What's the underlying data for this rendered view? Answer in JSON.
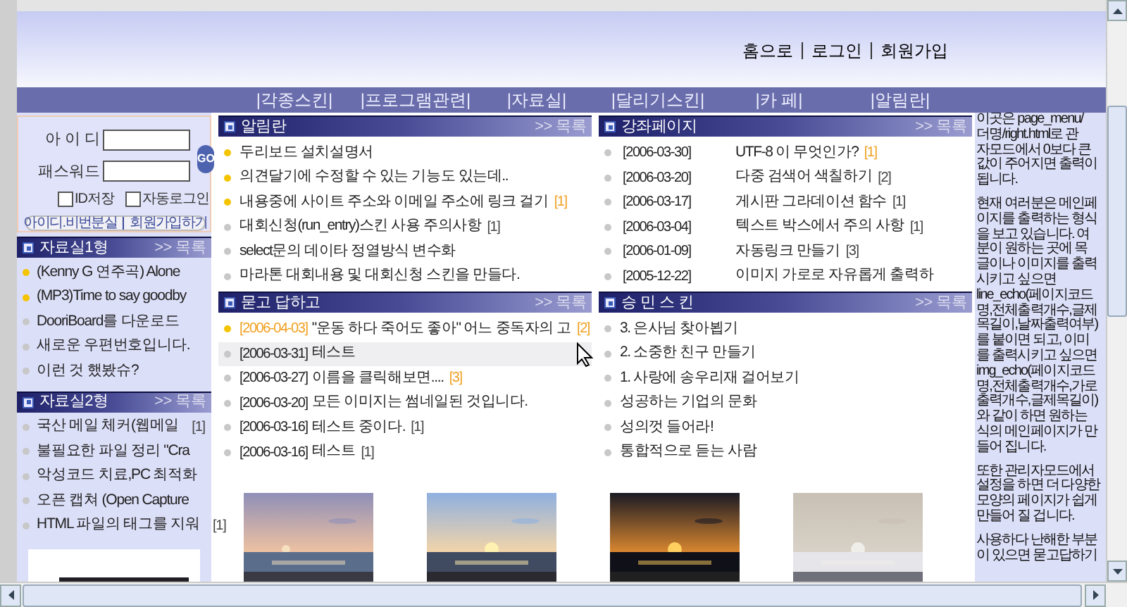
{
  "top_links": [
    {
      "label": "홈으로"
    },
    {
      "label": "로그인"
    },
    {
      "label": "회원가입"
    }
  ],
  "nav": [
    "|각종스킨|",
    "|프로그램관련|",
    "|자료실|",
    "|달리기스킨|",
    "|카 페|",
    "|알림란|"
  ],
  "login": {
    "id_label": "아 이 디",
    "pw_label": "패스워드",
    "go": "GO",
    "checks": [
      {
        "label": "ID저장",
        "checked": false
      },
      {
        "label": "자동로그인",
        "checked": false
      }
    ],
    "links": [
      "아이디.비번분실",
      "회원가입하기"
    ]
  },
  "left_sections": [
    {
      "title": "자료실1형",
      "more": ">> 목록",
      "items": [
        {
          "text": "(Kenny G 연주곡) Alone",
          "new": true
        },
        {
          "text": "(MP3)Time to say goodby",
          "new": true
        },
        {
          "text": "DooriBoard를 다운로드",
          "new": false
        },
        {
          "text": "새로운 우편번호입니다.",
          "new": false
        },
        {
          "text": "이런 것 했봤슈?",
          "new": false
        }
      ]
    },
    {
      "title": "자료실2형",
      "more": ">> 목록",
      "items": [
        {
          "text": "국산 메일 체커(웹메일",
          "count": "[1]",
          "new": false
        },
        {
          "text": "불필요한 파일 정리 \"Cra",
          "new": false
        },
        {
          "text": "악성코드 치료,PC 최적화",
          "new": false
        },
        {
          "text": "오픈 캡쳐 (Open Capture",
          "new": false
        },
        {
          "text": "HTML 파일의 태그를 지워",
          "count": "[1]",
          "new": false
        }
      ]
    }
  ],
  "sections": [
    {
      "title": "알림란",
      "more": ">> 목록",
      "kind": "plain",
      "items": [
        {
          "text": "두리보드 설치설명서",
          "new": true
        },
        {
          "text": "의견달기에 수정할 수 있는 기능도 있는데..",
          "new": true
        },
        {
          "text": "내용중에 사이트 주소와 이메일 주소에 링크 걸기",
          "count": "[1]",
          "count_highlighted": true,
          "new": true
        },
        {
          "text": "대회신청(run_entry)스킨 사용 주의사항",
          "count": "[1]",
          "count_highlighted": false,
          "new": false
        },
        {
          "text": "select문의 데이타 정열방식 변수화",
          "new": false
        },
        {
          "text": "마라톤 대회내용 및 대회신청 스킨을 만들다.",
          "new": false
        }
      ]
    },
    {
      "title": "강좌페이지",
      "more": ">> 목록",
      "kind": "dated_columns",
      "items": [
        {
          "date": "[2006-03-30]",
          "text": "UTF-8 이 무엇인가?",
          "count": "[1]",
          "count_highlighted": true,
          "new": false
        },
        {
          "date": "[2006-03-20]",
          "text": "다중 검색어 색칠하기",
          "count": "[2]",
          "count_highlighted": false,
          "new": false
        },
        {
          "date": "[2006-03-17]",
          "text": "게시판 그라데이션 함수",
          "count": "[1]",
          "count_highlighted": false,
          "new": false
        },
        {
          "date": "[2006-03-04]",
          "text": "텍스트 박스에서 주의 사항",
          "count": "[1]",
          "count_highlighted": false,
          "new": false
        },
        {
          "date": "[2006-01-09]",
          "text": "자동링크 만들기",
          "count": "[3]",
          "count_highlighted": false,
          "new": false
        },
        {
          "date": "[2005-12-22]",
          "text": "이미지 가로로 자유롭게 출력하",
          "new": false
        }
      ]
    },
    {
      "title": "묻고 답하고",
      "more": ">> 목록",
      "kind": "dated",
      "items": [
        {
          "date": "[2006-04-03]",
          "date_highlighted": true,
          "text": "\"운동 하다 죽어도 좋아\" 어느 중독자의 고",
          "count": "[2]",
          "count_highlighted": true,
          "new": true,
          "selected": false
        },
        {
          "date": "[2006-03-31]",
          "date_highlighted": false,
          "text": "테스트",
          "new": false,
          "selected": true
        },
        {
          "date": "[2006-03-27]",
          "date_highlighted": false,
          "text": "이름을 클릭해보면....",
          "count": "[3]",
          "count_highlighted": true,
          "new": false,
          "selected": false
        },
        {
          "date": "[2006-03-20]",
          "date_highlighted": false,
          "text": "모든 이미지는 썸네일된 것입니다.",
          "new": false,
          "selected": false
        },
        {
          "date": "[2006-03-16]",
          "date_highlighted": false,
          "text": "테스트 중이다.",
          "count": "[1]",
          "count_highlighted": false,
          "new": false,
          "selected": false
        },
        {
          "date": "[2006-03-16]",
          "date_highlighted": false,
          "text": "테스트",
          "count": "[1]",
          "count_highlighted": false,
          "new": false,
          "selected": false
        }
      ]
    },
    {
      "title": "승 민 스 킨",
      "more": ">> 목록",
      "kind": "plain",
      "items": [
        {
          "text": "3. 은사님 찾아뵙기",
          "new": false
        },
        {
          "text": "2. 소중한 친구 만들기",
          "new": false
        },
        {
          "text": "1. 사랑에 송우리재 걸어보기",
          "new": false
        },
        {
          "text": "성공하는 기업의 문화",
          "new": false
        },
        {
          "text": "성의껏 들어라!",
          "new": false
        },
        {
          "text": "통합적으로 듣는 사람",
          "new": false
        }
      ]
    }
  ],
  "gallery": [
    {
      "kind": "picture"
    },
    {
      "kind": "picture"
    },
    {
      "kind": "picture"
    },
    {
      "kind": "picture"
    }
  ],
  "side_text": [
    [
      "이곳은 page_menu/",
      "더명/right.html로 관",
      "자모드에서 0보다 큰",
      "값이 주어지면 출력이",
      "됩니다."
    ],
    [
      "현재 여러분은 메인페",
      "이지를 출력하는 형식",
      "을 보고 있습니다. 여",
      "분이 원하는 곳에 목",
      "글이나 이미지를 출력",
      "시키고 싶으면",
      "line_echo(페이지코드",
      "명,전체출력개수,글제",
      "목길이,날짜출력여부)",
      "를 붙이면 되고, 이미",
      "를 출력시키고 싶으면",
      "img_echo(페이지코드",
      "명,전체출력개수,가로",
      "출력개수,글제목길이)",
      "와 같이 하면 원하는",
      "식의 메인페이지가 만",
      "들어 집니다."
    ],
    [
      "또한 관리자모드에서",
      "설정을 하면 더 다양한",
      "모양의 페이지가 쉽게",
      "만들어 질 겁니다."
    ],
    [
      "사용하다 난해한 부분",
      "이 있으면 묻고답하기"
    ]
  ]
}
